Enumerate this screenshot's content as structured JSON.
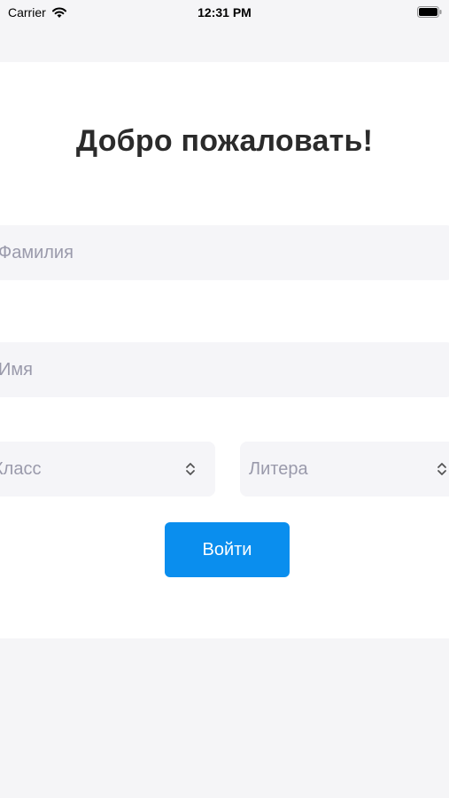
{
  "status_bar": {
    "carrier": "Carrier",
    "time": "12:31 PM"
  },
  "main": {
    "title": "Добро пожаловать!",
    "last_name_placeholder": "Фамилия",
    "first_name_placeholder": "Имя",
    "class_select_placeholder": "Класс",
    "letter_select_placeholder": "Литера",
    "login_label": "Войти"
  },
  "colors": {
    "accent": "#0a8eee",
    "background": "#f5f5f7",
    "field_background": "#f5f5f8",
    "placeholder_text": "#9a9aab",
    "title_text": "#2b2b2b"
  }
}
